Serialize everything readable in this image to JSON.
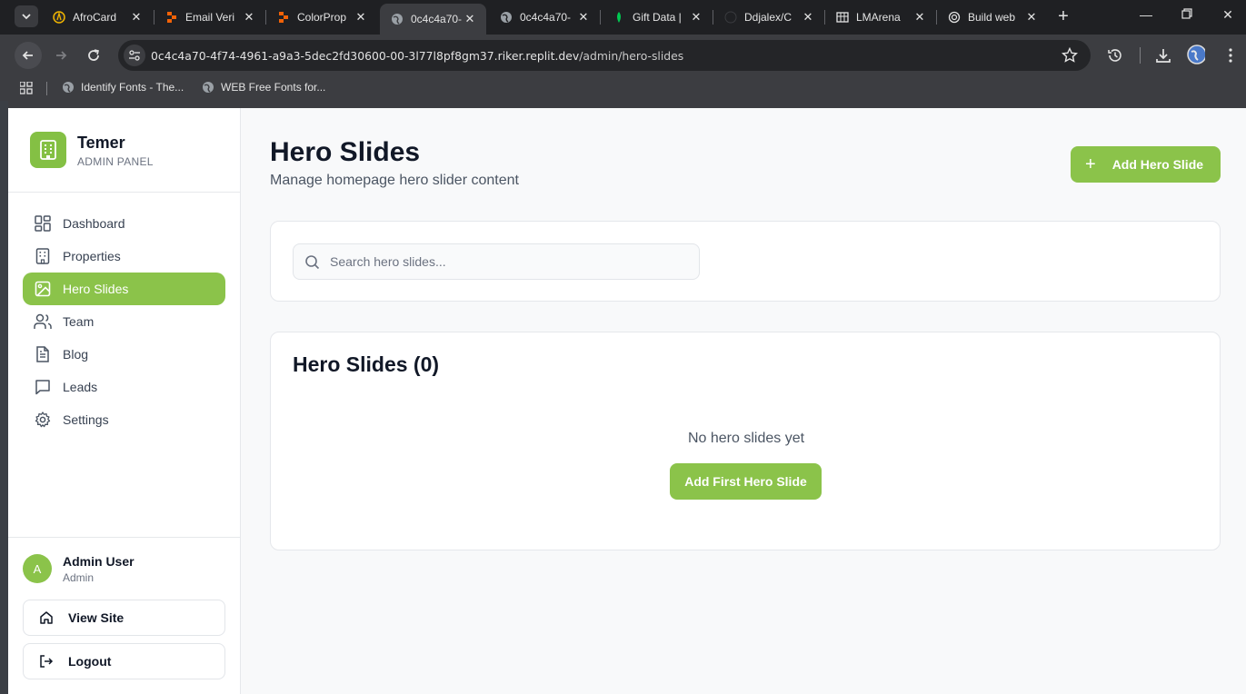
{
  "browser": {
    "tabs": [
      {
        "title": "AfroCard",
        "icon": "afrocard-icon",
        "active": false
      },
      {
        "title": "Email Veri",
        "icon": "replit-icon",
        "active": false
      },
      {
        "title": "ColorProp",
        "icon": "replit-icon",
        "active": false
      },
      {
        "title": "0c4c4a70-",
        "icon": "globe-icon",
        "active": true
      },
      {
        "title": "0c4c4a70-",
        "icon": "globe-icon",
        "active": false
      },
      {
        "title": "Gift Data |",
        "icon": "leaf-icon",
        "active": false
      },
      {
        "title": "Ddjalex/C",
        "icon": "github-icon",
        "active": false
      },
      {
        "title": "LMArena",
        "icon": "grid-icon",
        "active": false
      },
      {
        "title": "Build web",
        "icon": "openai-icon",
        "active": false
      }
    ],
    "url_host": "0c4c4a70-4f74-4961-a9a3-5dec2fd30600-00-3l77l8pf8gm37.riker.replit.dev",
    "url_path": "/admin/hero-slides",
    "bookmarks": [
      {
        "label": "Identify Fonts - The..."
      },
      {
        "label": "WEB Free Fonts for..."
      }
    ]
  },
  "sidebar": {
    "brand_name": "Temer",
    "brand_sub": "ADMIN PANEL",
    "items": [
      {
        "label": "Dashboard",
        "icon": "dashboard-icon"
      },
      {
        "label": "Properties",
        "icon": "building-icon"
      },
      {
        "label": "Hero Slides",
        "icon": "image-icon",
        "active": true
      },
      {
        "label": "Team",
        "icon": "users-icon"
      },
      {
        "label": "Blog",
        "icon": "file-text-icon"
      },
      {
        "label": "Leads",
        "icon": "message-icon"
      },
      {
        "label": "Settings",
        "icon": "gear-icon"
      }
    ],
    "user": {
      "initial": "A",
      "name": "Admin User",
      "role": "Admin"
    },
    "view_site": "View Site",
    "logout": "Logout"
  },
  "main": {
    "title": "Hero Slides",
    "subtitle": "Manage homepage hero slider content",
    "add_button": "Add Hero Slide",
    "search_placeholder": "Search hero slides...",
    "list_title": "Hero Slides (0)",
    "empty_text": "No hero slides yet",
    "first_button": "Add First Hero Slide"
  },
  "colors": {
    "accent": "#8bc34a",
    "brand_logo": "#84c044",
    "page_bg": "#f8f9fa"
  }
}
